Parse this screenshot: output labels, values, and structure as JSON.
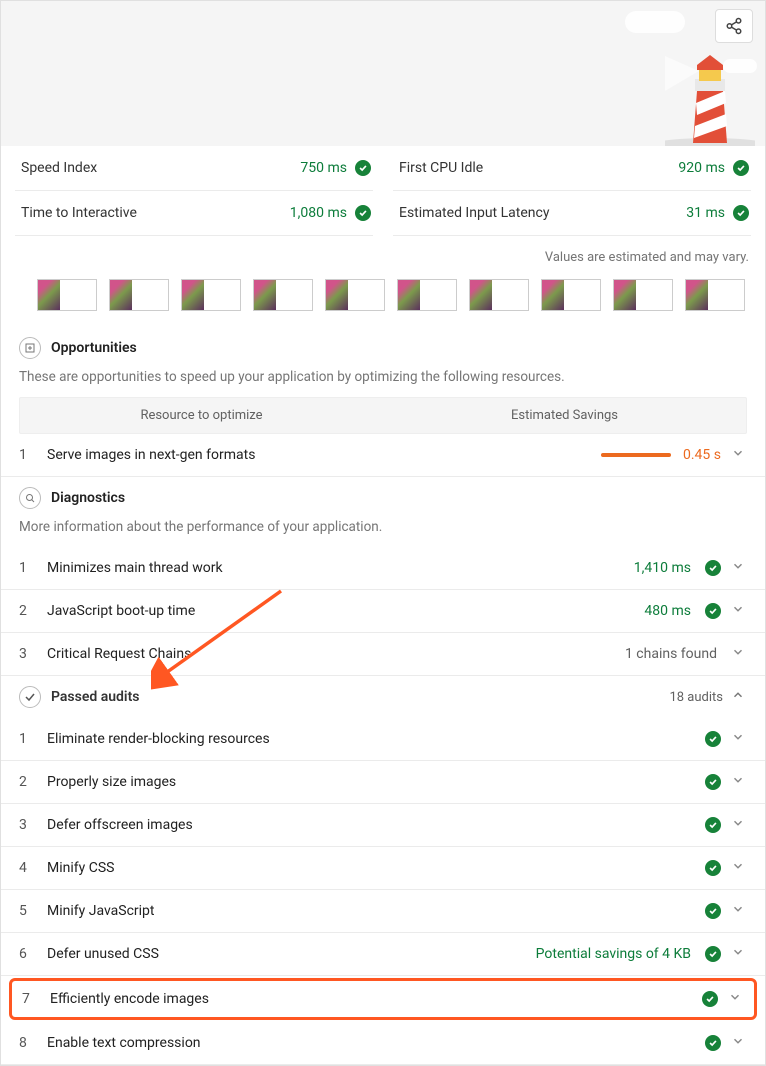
{
  "share_label": "Share",
  "metrics": [
    {
      "label": "Speed Index",
      "value": "750 ms",
      "pass": true
    },
    {
      "label": "First CPU Idle",
      "value": "920 ms",
      "pass": true
    },
    {
      "label": "Time to Interactive",
      "value": "1,080 ms",
      "pass": true
    },
    {
      "label": "Estimated Input Latency",
      "value": "31 ms",
      "pass": true
    }
  ],
  "estimate_note": "Values are estimated and may vary.",
  "filmstrip_count": 10,
  "opportunities": {
    "heading": "Opportunities",
    "description": "These are opportunities to speed up your application by optimizing the following resources.",
    "columns": [
      "Resource to optimize",
      "Estimated Savings"
    ],
    "items": [
      {
        "num": "1",
        "title": "Serve images in next-gen formats",
        "savings": "0.45 s"
      }
    ]
  },
  "diagnostics": {
    "heading": "Diagnostics",
    "description": "More information about the performance of your application.",
    "items": [
      {
        "num": "1",
        "title": "Minimizes main thread work",
        "value": "1,410 ms",
        "pass": true
      },
      {
        "num": "2",
        "title": "JavaScript boot-up time",
        "value": "480 ms",
        "pass": true
      },
      {
        "num": "3",
        "title": "Critical Request Chains",
        "value": "1 chains found",
        "grey": true
      }
    ]
  },
  "passed": {
    "heading": "Passed audits",
    "count": "18 audits",
    "items": [
      {
        "num": "1",
        "title": "Eliminate render-blocking resources"
      },
      {
        "num": "2",
        "title": "Properly size images"
      },
      {
        "num": "3",
        "title": "Defer offscreen images"
      },
      {
        "num": "4",
        "title": "Minify CSS"
      },
      {
        "num": "5",
        "title": "Minify JavaScript"
      },
      {
        "num": "6",
        "title": "Defer unused CSS",
        "note": "Potential savings of 4 KB"
      },
      {
        "num": "7",
        "title": "Efficiently encode images",
        "highlighted": true
      },
      {
        "num": "8",
        "title": "Enable text compression"
      }
    ]
  }
}
